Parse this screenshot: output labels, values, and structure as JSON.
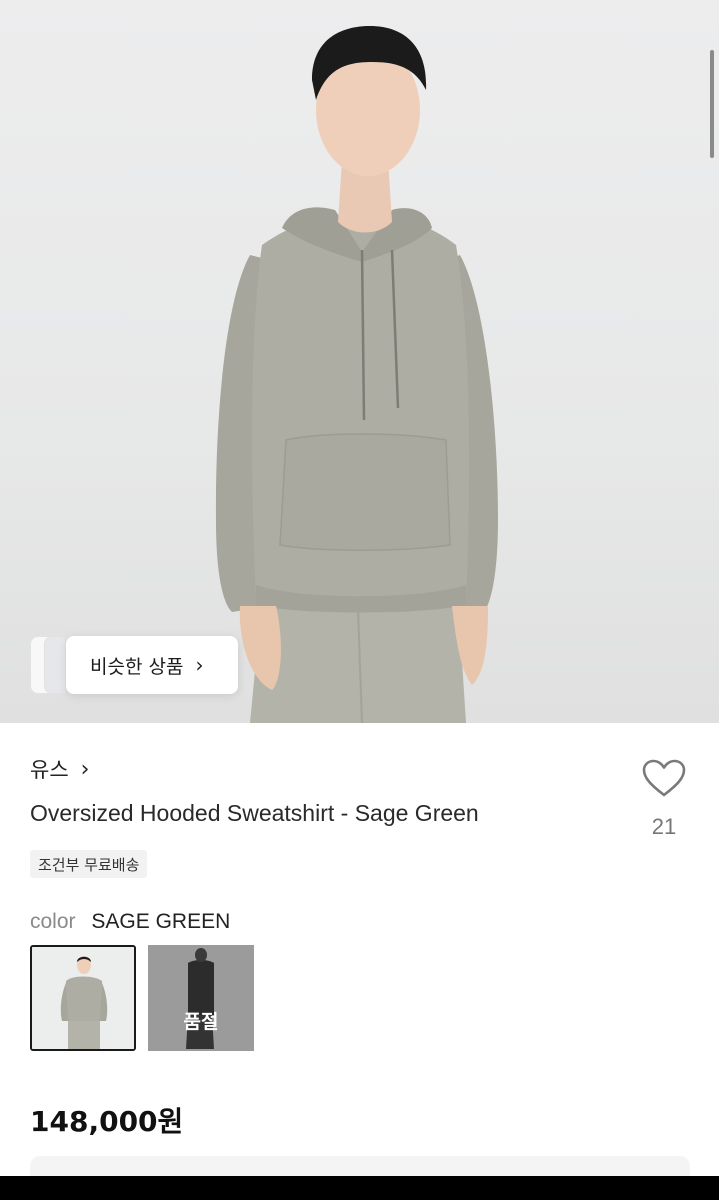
{
  "product": {
    "brand": "유스",
    "brand_chevron": "›",
    "title": "Oversized Hooded Sweatshirt - Sage Green",
    "shipping_badge": "조건부 무료배송",
    "like_count": "21",
    "price": "148,000원"
  },
  "similar": {
    "label": "비슷한 상품",
    "chevron": "›"
  },
  "color": {
    "label": "color",
    "value": "SAGE GREEN",
    "options": [
      {
        "name": "SAGE GREEN",
        "selected": true,
        "sold_out": false
      },
      {
        "name": "",
        "selected": false,
        "sold_out": true,
        "sold_out_label": "품절"
      }
    ]
  },
  "icons": {
    "like": "heart-icon",
    "brand_link": "chevron-right-icon",
    "similar_link": "chevron-right-icon"
  },
  "colors": {
    "hoodie": "#a8a89e",
    "background": "#eceded",
    "text_primary": "#1a1a1a",
    "text_muted": "#8a8a8a"
  }
}
